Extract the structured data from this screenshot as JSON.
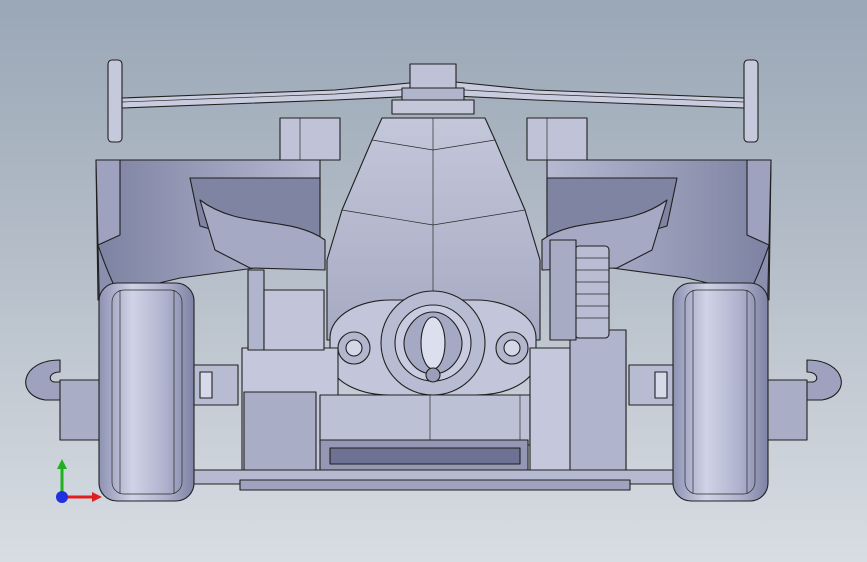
{
  "viewport": {
    "background_top": "#9aa7b6",
    "background_bottom": "#d8dde3"
  },
  "model": {
    "name_icon": "race-car-front-view",
    "body_color": "#b9bdd2",
    "shadow_color": "#8e93ad",
    "highlight_color": "#d7daea"
  },
  "triad": {
    "icon": "xyz-axis-triad",
    "x_color": "#e02020",
    "y_color": "#20b020",
    "z_color": "#2030e0"
  }
}
